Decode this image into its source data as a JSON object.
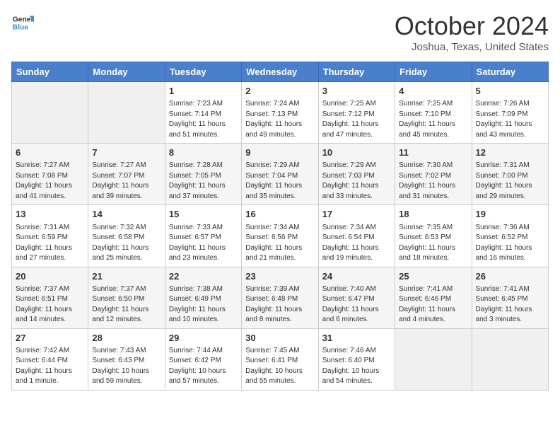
{
  "header": {
    "logo_line1": "General",
    "logo_line2": "Blue",
    "title": "October 2024",
    "subtitle": "Joshua, Texas, United States"
  },
  "days_of_week": [
    "Sunday",
    "Monday",
    "Tuesday",
    "Wednesday",
    "Thursday",
    "Friday",
    "Saturday"
  ],
  "weeks": [
    [
      {
        "day": "",
        "info": ""
      },
      {
        "day": "",
        "info": ""
      },
      {
        "day": "1",
        "info": "Sunrise: 7:23 AM\nSunset: 7:14 PM\nDaylight: 11 hours and 51 minutes."
      },
      {
        "day": "2",
        "info": "Sunrise: 7:24 AM\nSunset: 7:13 PM\nDaylight: 11 hours and 49 minutes."
      },
      {
        "day": "3",
        "info": "Sunrise: 7:25 AM\nSunset: 7:12 PM\nDaylight: 11 hours and 47 minutes."
      },
      {
        "day": "4",
        "info": "Sunrise: 7:25 AM\nSunset: 7:10 PM\nDaylight: 11 hours and 45 minutes."
      },
      {
        "day": "5",
        "info": "Sunrise: 7:26 AM\nSunset: 7:09 PM\nDaylight: 11 hours and 43 minutes."
      }
    ],
    [
      {
        "day": "6",
        "info": "Sunrise: 7:27 AM\nSunset: 7:08 PM\nDaylight: 11 hours and 41 minutes."
      },
      {
        "day": "7",
        "info": "Sunrise: 7:27 AM\nSunset: 7:07 PM\nDaylight: 11 hours and 39 minutes."
      },
      {
        "day": "8",
        "info": "Sunrise: 7:28 AM\nSunset: 7:05 PM\nDaylight: 11 hours and 37 minutes."
      },
      {
        "day": "9",
        "info": "Sunrise: 7:29 AM\nSunset: 7:04 PM\nDaylight: 11 hours and 35 minutes."
      },
      {
        "day": "10",
        "info": "Sunrise: 7:29 AM\nSunset: 7:03 PM\nDaylight: 11 hours and 33 minutes."
      },
      {
        "day": "11",
        "info": "Sunrise: 7:30 AM\nSunset: 7:02 PM\nDaylight: 11 hours and 31 minutes."
      },
      {
        "day": "12",
        "info": "Sunrise: 7:31 AM\nSunset: 7:00 PM\nDaylight: 11 hours and 29 minutes."
      }
    ],
    [
      {
        "day": "13",
        "info": "Sunrise: 7:31 AM\nSunset: 6:59 PM\nDaylight: 11 hours and 27 minutes."
      },
      {
        "day": "14",
        "info": "Sunrise: 7:32 AM\nSunset: 6:58 PM\nDaylight: 11 hours and 25 minutes."
      },
      {
        "day": "15",
        "info": "Sunrise: 7:33 AM\nSunset: 6:57 PM\nDaylight: 11 hours and 23 minutes."
      },
      {
        "day": "16",
        "info": "Sunrise: 7:34 AM\nSunset: 6:56 PM\nDaylight: 11 hours and 21 minutes."
      },
      {
        "day": "17",
        "info": "Sunrise: 7:34 AM\nSunset: 6:54 PM\nDaylight: 11 hours and 19 minutes."
      },
      {
        "day": "18",
        "info": "Sunrise: 7:35 AM\nSunset: 6:53 PM\nDaylight: 11 hours and 18 minutes."
      },
      {
        "day": "19",
        "info": "Sunrise: 7:36 AM\nSunset: 6:52 PM\nDaylight: 11 hours and 16 minutes."
      }
    ],
    [
      {
        "day": "20",
        "info": "Sunrise: 7:37 AM\nSunset: 6:51 PM\nDaylight: 11 hours and 14 minutes."
      },
      {
        "day": "21",
        "info": "Sunrise: 7:37 AM\nSunset: 6:50 PM\nDaylight: 11 hours and 12 minutes."
      },
      {
        "day": "22",
        "info": "Sunrise: 7:38 AM\nSunset: 6:49 PM\nDaylight: 11 hours and 10 minutes."
      },
      {
        "day": "23",
        "info": "Sunrise: 7:39 AM\nSunset: 6:48 PM\nDaylight: 11 hours and 8 minutes."
      },
      {
        "day": "24",
        "info": "Sunrise: 7:40 AM\nSunset: 6:47 PM\nDaylight: 11 hours and 6 minutes."
      },
      {
        "day": "25",
        "info": "Sunrise: 7:41 AM\nSunset: 6:46 PM\nDaylight: 11 hours and 4 minutes."
      },
      {
        "day": "26",
        "info": "Sunrise: 7:41 AM\nSunset: 6:45 PM\nDaylight: 11 hours and 3 minutes."
      }
    ],
    [
      {
        "day": "27",
        "info": "Sunrise: 7:42 AM\nSunset: 6:44 PM\nDaylight: 11 hours and 1 minute."
      },
      {
        "day": "28",
        "info": "Sunrise: 7:43 AM\nSunset: 6:43 PM\nDaylight: 10 hours and 59 minutes."
      },
      {
        "day": "29",
        "info": "Sunrise: 7:44 AM\nSunset: 6:42 PM\nDaylight: 10 hours and 57 minutes."
      },
      {
        "day": "30",
        "info": "Sunrise: 7:45 AM\nSunset: 6:41 PM\nDaylight: 10 hours and 55 minutes."
      },
      {
        "day": "31",
        "info": "Sunrise: 7:46 AM\nSunset: 6:40 PM\nDaylight: 10 hours and 54 minutes."
      },
      {
        "day": "",
        "info": ""
      },
      {
        "day": "",
        "info": ""
      }
    ]
  ]
}
